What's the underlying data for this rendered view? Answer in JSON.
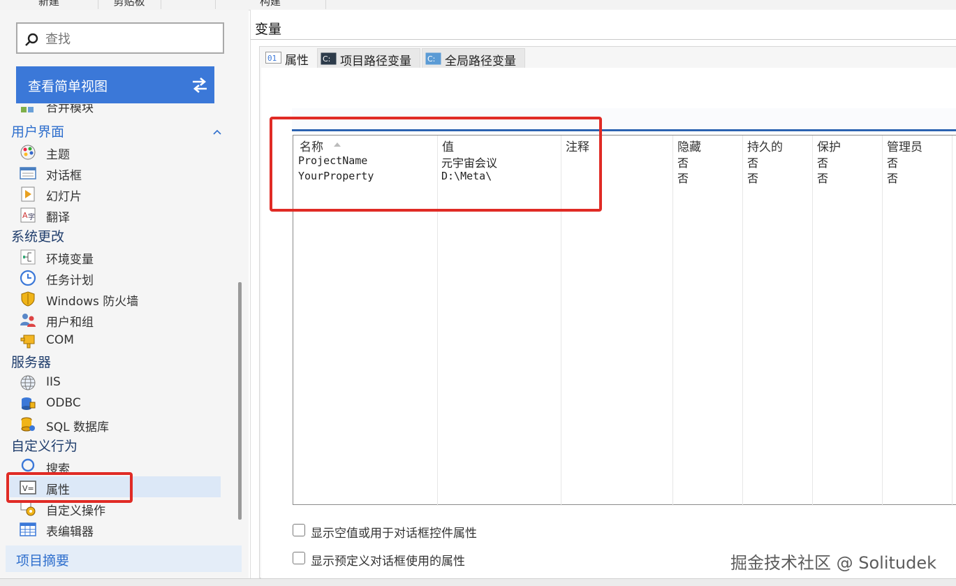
{
  "ribbon": {
    "groups": [
      "新建",
      "剪贴板",
      "构建"
    ]
  },
  "sidebar": {
    "search_placeholder": "查找",
    "simple_view_label": "查看简单视图",
    "partial_item": "合并模块",
    "categories": {
      "ui": "用户界面",
      "system": "系统更改",
      "server": "服务器",
      "custom": "自定义行为"
    },
    "items": {
      "theme": "主题",
      "dialog": "对话框",
      "slideshow": "幻灯片",
      "translate": "翻译",
      "env_vars": "环境变量",
      "task_schedule": "任务计划",
      "firewall": "Windows 防火墙",
      "users_groups": "用户和组",
      "com": "COM",
      "iis": "IIS",
      "odbc": "ODBC",
      "sql": "SQL 数据库",
      "search": "搜索",
      "properties": "属性",
      "custom_actions": "自定义操作",
      "table_editor": "表编辑器"
    },
    "summary": "项目摘要"
  },
  "main": {
    "title": "变量",
    "tabs": [
      {
        "label": "属性",
        "icon": "01"
      },
      {
        "label": "项目路径变量",
        "icon": "C:"
      },
      {
        "label": "全局路径变量",
        "icon": "C:"
      }
    ],
    "columns": [
      "名称",
      "值",
      "注释",
      "隐藏",
      "持久的",
      "保护",
      "管理员"
    ],
    "rows": [
      {
        "name": "ProjectName",
        "value": "元宇宙会议",
        "comment": "",
        "hidden": "否",
        "persistent": "否",
        "protected": "否",
        "admin": "否"
      },
      {
        "name": "YourProperty",
        "value": "D:\\Meta\\",
        "comment": "",
        "hidden": "否",
        "persistent": "否",
        "protected": "否",
        "admin": "否"
      }
    ],
    "checkboxes": [
      {
        "label": "显示空值或用于对话框控件属性",
        "checked": false
      },
      {
        "label": "显示预定义对话框使用的属性",
        "checked": false
      }
    ]
  },
  "watermark": "掘金技术社区 @ Solitudek",
  "colors": {
    "accent": "#3b78d8",
    "highlight": "#e02b25",
    "category_blue": "#2f6fcd",
    "selected_bg": "#dce8f7"
  }
}
